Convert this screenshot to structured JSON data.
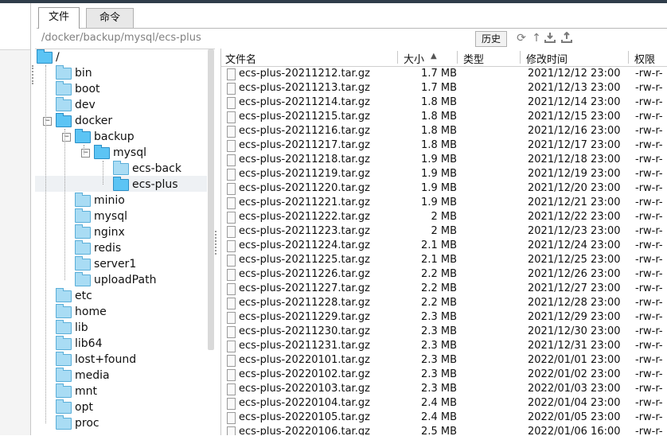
{
  "tabs": [
    {
      "label": "文件",
      "active": true
    },
    {
      "label": "命令",
      "active": false
    }
  ],
  "path": {
    "value": "/docker/backup/mysql/ecs-plus",
    "history_label": "历史"
  },
  "toolbar_icons": [
    "refresh-icon",
    "go-up-icon",
    "download-icon",
    "upload-icon"
  ],
  "tree": {
    "root": "/",
    "nodes": [
      {
        "label": "bin",
        "level": 1
      },
      {
        "label": "boot",
        "level": 1
      },
      {
        "label": "dev",
        "level": 1
      },
      {
        "label": "docker",
        "level": 1,
        "expanded": true
      },
      {
        "label": "backup",
        "level": 2,
        "expanded": true
      },
      {
        "label": "mysql",
        "level": 3,
        "expanded": true
      },
      {
        "label": "ecs-back",
        "level": 4
      },
      {
        "label": "ecs-plus",
        "level": 4,
        "selected": true
      },
      {
        "label": "minio",
        "level": 2
      },
      {
        "label": "mysql",
        "level": 2
      },
      {
        "label": "nginx",
        "level": 2
      },
      {
        "label": "redis",
        "level": 2
      },
      {
        "label": "server1",
        "level": 2
      },
      {
        "label": "uploadPath",
        "level": 2
      },
      {
        "label": "etc",
        "level": 1
      },
      {
        "label": "home",
        "level": 1
      },
      {
        "label": "lib",
        "level": 1
      },
      {
        "label": "lib64",
        "level": 1
      },
      {
        "label": "lost+found",
        "level": 1
      },
      {
        "label": "media",
        "level": 1
      },
      {
        "label": "mnt",
        "level": 1
      },
      {
        "label": "opt",
        "level": 1
      },
      {
        "label": "proc",
        "level": 1
      }
    ]
  },
  "files": {
    "columns": {
      "name": "文件名",
      "size": "大小",
      "type": "类型",
      "modified": "修改时间",
      "perm": "权限"
    },
    "rows": [
      {
        "name": "ecs-plus-20211212.tar.gz",
        "size": "1.7 MB",
        "modified": "2021/12/12 23:00",
        "perm": "-rw-r-"
      },
      {
        "name": "ecs-plus-20211213.tar.gz",
        "size": "1.7 MB",
        "modified": "2021/12/13 23:00",
        "perm": "-rw-r-"
      },
      {
        "name": "ecs-plus-20211214.tar.gz",
        "size": "1.8 MB",
        "modified": "2021/12/14 23:00",
        "perm": "-rw-r-"
      },
      {
        "name": "ecs-plus-20211215.tar.gz",
        "size": "1.8 MB",
        "modified": "2021/12/15 23:00",
        "perm": "-rw-r-"
      },
      {
        "name": "ecs-plus-20211216.tar.gz",
        "size": "1.8 MB",
        "modified": "2021/12/16 23:00",
        "perm": "-rw-r-"
      },
      {
        "name": "ecs-plus-20211217.tar.gz",
        "size": "1.8 MB",
        "modified": "2021/12/17 23:00",
        "perm": "-rw-r-"
      },
      {
        "name": "ecs-plus-20211218.tar.gz",
        "size": "1.9 MB",
        "modified": "2021/12/18 23:00",
        "perm": "-rw-r-"
      },
      {
        "name": "ecs-plus-20211219.tar.gz",
        "size": "1.9 MB",
        "modified": "2021/12/19 23:00",
        "perm": "-rw-r-"
      },
      {
        "name": "ecs-plus-20211220.tar.gz",
        "size": "1.9 MB",
        "modified": "2021/12/20 23:00",
        "perm": "-rw-r-"
      },
      {
        "name": "ecs-plus-20211221.tar.gz",
        "size": "1.9 MB",
        "modified": "2021/12/21 23:00",
        "perm": "-rw-r-"
      },
      {
        "name": "ecs-plus-20211222.tar.gz",
        "size": "2 MB",
        "modified": "2021/12/22 23:00",
        "perm": "-rw-r-"
      },
      {
        "name": "ecs-plus-20211223.tar.gz",
        "size": "2 MB",
        "modified": "2021/12/23 23:00",
        "perm": "-rw-r-"
      },
      {
        "name": "ecs-plus-20211224.tar.gz",
        "size": "2.1 MB",
        "modified": "2021/12/24 23:00",
        "perm": "-rw-r-"
      },
      {
        "name": "ecs-plus-20211225.tar.gz",
        "size": "2.1 MB",
        "modified": "2021/12/25 23:00",
        "perm": "-rw-r-"
      },
      {
        "name": "ecs-plus-20211226.tar.gz",
        "size": "2.2 MB",
        "modified": "2021/12/26 23:00",
        "perm": "-rw-r-"
      },
      {
        "name": "ecs-plus-20211227.tar.gz",
        "size": "2.2 MB",
        "modified": "2021/12/27 23:00",
        "perm": "-rw-r-"
      },
      {
        "name": "ecs-plus-20211228.tar.gz",
        "size": "2.2 MB",
        "modified": "2021/12/28 23:00",
        "perm": "-rw-r-"
      },
      {
        "name": "ecs-plus-20211229.tar.gz",
        "size": "2.3 MB",
        "modified": "2021/12/29 23:00",
        "perm": "-rw-r-"
      },
      {
        "name": "ecs-plus-20211230.tar.gz",
        "size": "2.3 MB",
        "modified": "2021/12/30 23:00",
        "perm": "-rw-r-"
      },
      {
        "name": "ecs-plus-20211231.tar.gz",
        "size": "2.3 MB",
        "modified": "2021/12/31 23:00",
        "perm": "-rw-r-"
      },
      {
        "name": "ecs-plus-20220101.tar.gz",
        "size": "2.3 MB",
        "modified": "2022/01/01 23:00",
        "perm": "-rw-r-"
      },
      {
        "name": "ecs-plus-20220102.tar.gz",
        "size": "2.3 MB",
        "modified": "2022/01/02 23:00",
        "perm": "-rw-r-"
      },
      {
        "name": "ecs-plus-20220103.tar.gz",
        "size": "2.3 MB",
        "modified": "2022/01/03 23:00",
        "perm": "-rw-r-"
      },
      {
        "name": "ecs-plus-20220104.tar.gz",
        "size": "2.4 MB",
        "modified": "2022/01/04 23:00",
        "perm": "-rw-r-"
      },
      {
        "name": "ecs-plus-20220105.tar.gz",
        "size": "2.4 MB",
        "modified": "2022/01/05 23:00",
        "perm": "-rw-r-"
      },
      {
        "name": "ecs-plus-20220106.tar.gz",
        "size": "2.5 MB",
        "modified": "2022/01/06 16:00",
        "perm": "-rw-r-"
      }
    ]
  }
}
